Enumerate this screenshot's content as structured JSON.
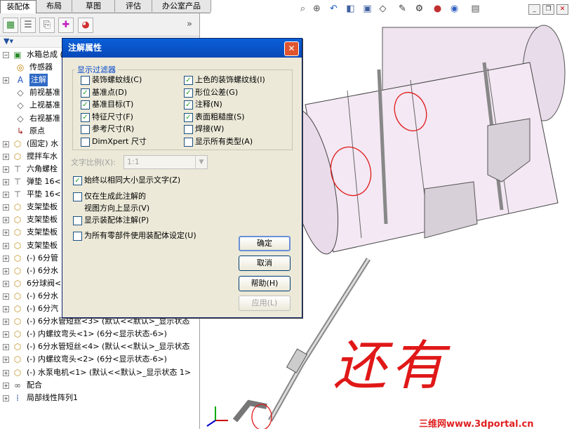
{
  "tabs": [
    "装配体",
    "布局",
    "草图",
    "评估",
    "办公室产品"
  ],
  "feature_tree": [
    {
      "label": "水箱总成  (",
      "icon": "assembly-icon",
      "indent": 0,
      "expand": "−"
    },
    {
      "label": "传感器",
      "icon": "sensor-icon",
      "indent": 1,
      "expand": ""
    },
    {
      "label": "注解",
      "icon": "annotation-icon",
      "indent": 1,
      "expand": "+",
      "selected": true
    },
    {
      "label": "前视基准",
      "icon": "plane-icon",
      "indent": 1,
      "expand": ""
    },
    {
      "label": "上视基准",
      "icon": "plane-icon",
      "indent": 1,
      "expand": ""
    },
    {
      "label": "右视基准",
      "icon": "plane-icon",
      "indent": 1,
      "expand": ""
    },
    {
      "label": "原点",
      "icon": "origin-icon",
      "indent": 1,
      "expand": ""
    },
    {
      "label": "(固定) 水",
      "icon": "part-icon",
      "indent": 0,
      "expand": "+"
    },
    {
      "label": "搅拌车水",
      "icon": "part-icon",
      "indent": 0,
      "expand": "+"
    },
    {
      "label": "六角螺栓",
      "icon": "bolt-icon",
      "indent": 0,
      "expand": "+"
    },
    {
      "label": "弹垫  16<",
      "icon": "bolt-icon",
      "indent": 0,
      "expand": "+"
    },
    {
      "label": "平垫  16<",
      "icon": "bolt-icon",
      "indent": 0,
      "expand": "+"
    },
    {
      "label": "支架垫板",
      "icon": "part-icon",
      "indent": 0,
      "expand": "+"
    },
    {
      "label": "支架垫板",
      "icon": "part-icon",
      "indent": 0,
      "expand": "+"
    },
    {
      "label": "支架垫板",
      "icon": "part-icon",
      "indent": 0,
      "expand": "+"
    },
    {
      "label": "支架垫板",
      "icon": "part-icon",
      "indent": 0,
      "expand": "+"
    },
    {
      "label": "(-)  6分管",
      "icon": "part-icon",
      "indent": 0,
      "expand": "+"
    },
    {
      "label": "(-)  6分水",
      "icon": "part-icon",
      "indent": 0,
      "expand": "+"
    },
    {
      "label": "6分球阀<",
      "icon": "part-icon",
      "indent": 0,
      "expand": "+"
    },
    {
      "label": "(-)  6分水",
      "icon": "part-icon",
      "indent": 0,
      "expand": "+"
    },
    {
      "label": "(-)  6分汽",
      "icon": "part-icon",
      "indent": 0,
      "expand": "+"
    },
    {
      "label": "(-)  6分水管短丝<3>  (默认<<默认>_显示状态",
      "icon": "part-icon",
      "indent": 0,
      "expand": "+"
    },
    {
      "label": "(-)  内螺纹弯头<1>  (6分<显示状态-6>)",
      "icon": "part-icon",
      "indent": 0,
      "expand": "+"
    },
    {
      "label": "(-)  6分水管短丝<4>  (默认<<默认>_显示状态",
      "icon": "part-icon",
      "indent": 0,
      "expand": "+"
    },
    {
      "label": "(-)  内螺纹弯头<2>  (6分<显示状态-6>)",
      "icon": "part-icon",
      "indent": 0,
      "expand": "+"
    },
    {
      "label": "(-)  水泵电机<1>  (默认<<默认>_显示状态  1>",
      "icon": "part-icon",
      "indent": 0,
      "expand": "+"
    },
    {
      "label": "配合",
      "icon": "mate-icon",
      "indent": 0,
      "expand": "+"
    },
    {
      "label": "局部线性阵列1",
      "icon": "pattern-icon",
      "indent": 0,
      "expand": "+"
    }
  ],
  "dialog": {
    "title": "注解属性",
    "group_label": "显示过滤器",
    "filters_left": [
      {
        "label": "装饰螺蚊线(C)",
        "checked": false
      },
      {
        "label": "基准点(D)",
        "checked": true
      },
      {
        "label": "基准目标(T)",
        "checked": true
      },
      {
        "label": "特征尺寸(F)",
        "checked": true
      },
      {
        "label": "参考尺寸(R)",
        "checked": false
      },
      {
        "label": "DimXpert 尺寸",
        "checked": false
      }
    ],
    "filters_right": [
      {
        "label": "上色的装饰螺纹线(I)",
        "checked": true
      },
      {
        "label": "形位公差(G)",
        "checked": true
      },
      {
        "label": "注释(N)",
        "checked": true
      },
      {
        "label": "表面粗糙度(S)",
        "checked": true
      },
      {
        "label": "焊接(W)",
        "checked": false
      },
      {
        "label": "显示所有类型(A)",
        "checked": false
      }
    ],
    "text_scale_label": "文字比例(X):",
    "text_scale_value": "1:1",
    "options": [
      {
        "label": "始终以相同大小显示文字(Z)",
        "checked": true
      },
      {
        "label": "仅在生成此注解的",
        "checked": false,
        "line2": "视图方向上显示(V)"
      },
      {
        "label": "显示装配体注解(P)",
        "checked": false
      },
      {
        "label": "为所有零部件使用装配体设定(U)",
        "checked": false
      }
    ],
    "buttons": {
      "ok": "确定",
      "cancel": "取消",
      "help": "帮助(H)",
      "apply": "应用(L)"
    }
  },
  "view": {
    "handwriting": "还有",
    "watermark": "三维网www.3dportal.cn"
  },
  "colors": {
    "title_bar": "#0a5fd8",
    "tank": "#efe4f0",
    "annotation_red": "#e01818",
    "watermark_red": "#e02020",
    "selection": "#316ac5"
  }
}
